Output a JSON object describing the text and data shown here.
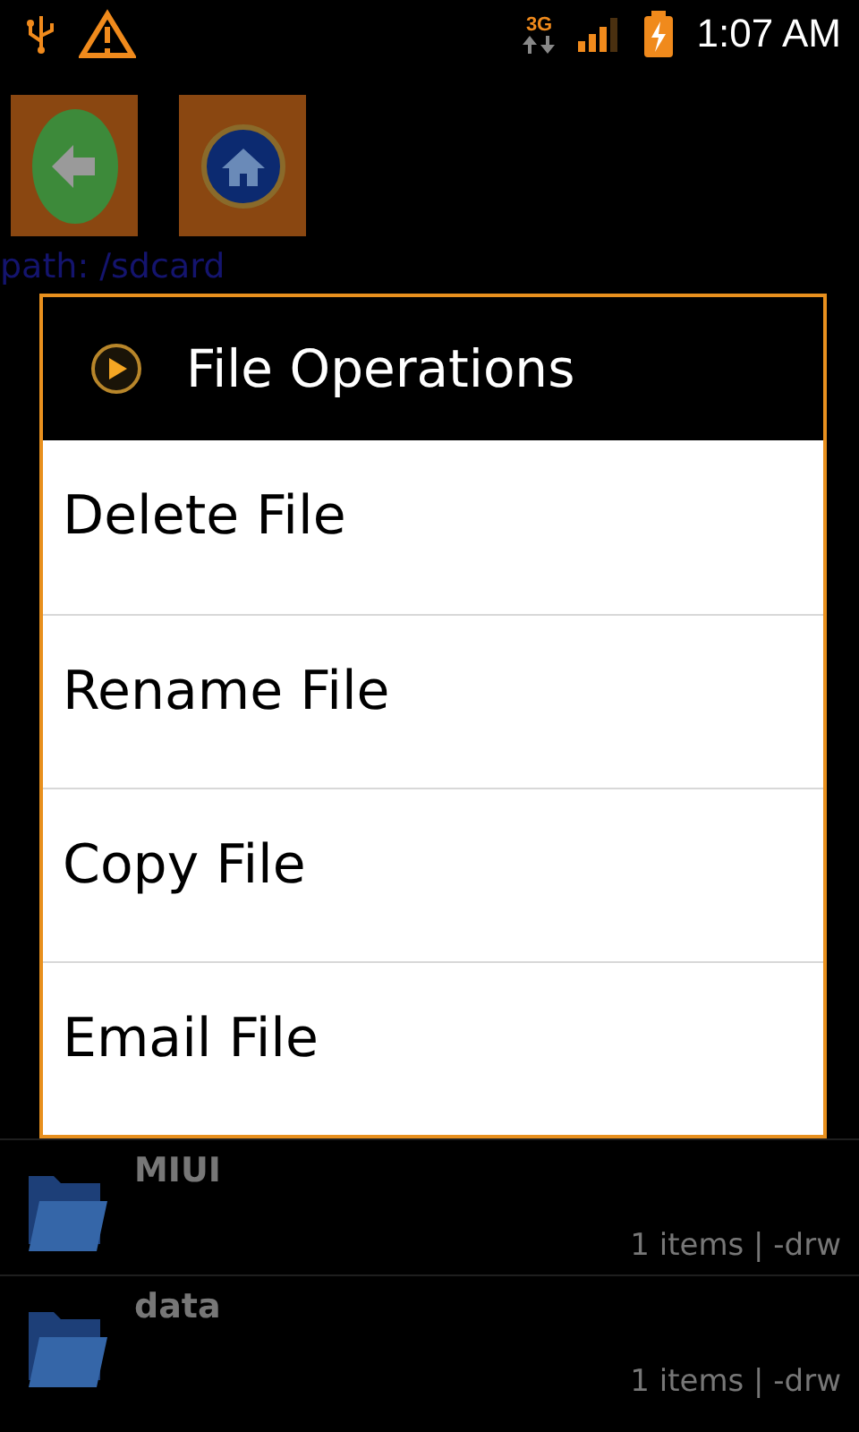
{
  "status_bar": {
    "network": "3G",
    "time": "1:07 AM"
  },
  "path": "path: /sdcard",
  "dialog": {
    "title": "File Operations",
    "items": [
      "Delete File",
      "Rename File",
      "Copy File",
      "Email File"
    ]
  },
  "files": [
    {
      "name": "MIUI",
      "info": "1 items | -drw"
    },
    {
      "name": "data",
      "info": "1 items | -drw"
    }
  ]
}
